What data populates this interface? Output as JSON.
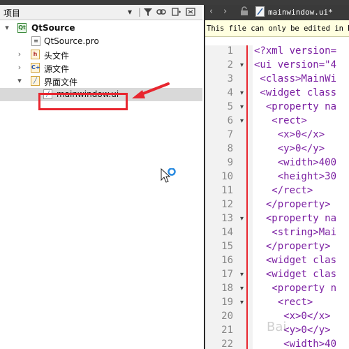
{
  "project_panel": {
    "title": "项目",
    "tree": [
      {
        "label": "QtSource",
        "icon": "qt-project-icon",
        "arrow": "▾"
      },
      {
        "label": "QtSource.pro",
        "icon": "pro-file-icon"
      },
      {
        "label": "头文件",
        "icon": "header-folder-icon",
        "arrow": "›"
      },
      {
        "label": "源文件",
        "icon": "source-folder-icon",
        "arrow": "›"
      },
      {
        "label": "界面文件",
        "icon": "forms-folder-icon",
        "arrow": "▾"
      },
      {
        "label": "mainwindow.ui",
        "icon": "ui-file-icon"
      }
    ],
    "highlight_color": "#e8262f"
  },
  "editor": {
    "tab_name": "mainwindow.ui*",
    "info_text": "This file can only be edited in De",
    "code_lines": [
      {
        "n": "1",
        "fold": "",
        "text": "<?xml version="
      },
      {
        "n": "2",
        "fold": "▾",
        "text": "<ui version=\"4"
      },
      {
        "n": "3",
        "fold": "",
        "text": " <class>MainWi"
      },
      {
        "n": "4",
        "fold": "▾",
        "text": " <widget class"
      },
      {
        "n": "5",
        "fold": "▾",
        "text": "  <property na"
      },
      {
        "n": "6",
        "fold": "▾",
        "text": "   <rect>"
      },
      {
        "n": "7",
        "fold": "",
        "text": "    <x>0</x>"
      },
      {
        "n": "8",
        "fold": "",
        "text": "    <y>0</y>"
      },
      {
        "n": "9",
        "fold": "",
        "text": "    <width>400"
      },
      {
        "n": "10",
        "fold": "",
        "text": "    <height>30"
      },
      {
        "n": "11",
        "fold": "",
        "text": "   </rect>"
      },
      {
        "n": "12",
        "fold": "",
        "text": "  </property>"
      },
      {
        "n": "13",
        "fold": "▾",
        "text": "  <property na"
      },
      {
        "n": "14",
        "fold": "",
        "text": "   <string>Mai"
      },
      {
        "n": "15",
        "fold": "",
        "text": "  </property>"
      },
      {
        "n": "16",
        "fold": "",
        "text": "  <widget clas"
      },
      {
        "n": "17",
        "fold": "▾",
        "text": "  <widget clas"
      },
      {
        "n": "18",
        "fold": "▾",
        "text": "   <property n"
      },
      {
        "n": "19",
        "fold": "▾",
        "text": "    <rect>"
      },
      {
        "n": "20",
        "fold": "",
        "text": "     <x>0</x>"
      },
      {
        "n": "21",
        "fold": "",
        "text": "     <y>0</y>"
      },
      {
        "n": "22",
        "fold": "",
        "text": "     <width>40"
      }
    ]
  },
  "watermark": "Bai"
}
